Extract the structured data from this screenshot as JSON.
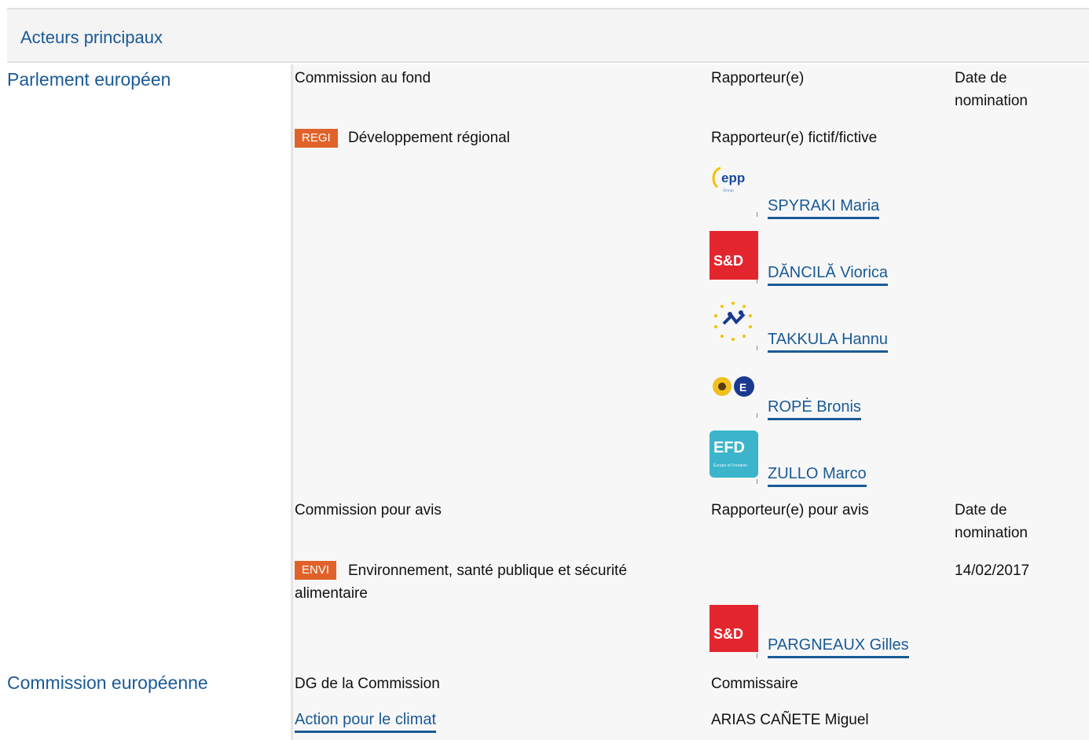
{
  "section": {
    "title": "Acteurs principaux"
  },
  "parliament": {
    "label": "Parlement européen",
    "lead": {
      "committee_header": "Commission au fond",
      "rapporteur_header": "Rapporteur(e)",
      "date_header": "Date de nomination",
      "committee_code": "REGI",
      "committee_name": "Développement régional",
      "shadow_header": "Rapporteur(e) fictif/fictive",
      "shadows": [
        {
          "group": "epp",
          "name": "SPYRAKI Maria"
        },
        {
          "group": "S&D",
          "name": "DĂNCILĂ Viorica"
        },
        {
          "group": "alde-stars",
          "name": "TAKKULA Hannu"
        },
        {
          "group": "greens-efa",
          "name": "ROPĖ Bronis"
        },
        {
          "group": "EFD",
          "name": "ZULLO Marco"
        }
      ]
    },
    "opinion": {
      "committee_header": "Commission pour avis",
      "rapporteur_header": "Rapporteur(e) pour avis",
      "date_header": "Date de nomination",
      "committee_code": "ENVI",
      "committee_name": "Environnement, santé publique et sécurité alimentaire",
      "date": "14/02/2017",
      "rapporteur": {
        "group": "S&D",
        "name": "PARGNEAUX Gilles"
      }
    }
  },
  "commission": {
    "label": "Commission européenne",
    "dg_header": "DG de la Commission",
    "commissioner_header": "Commissaire",
    "dg": "Action pour le climat",
    "commissioner": "ARIAS CAÑETE Miguel"
  },
  "colors": {
    "link": "#1a5a96",
    "badge": "#e0622a",
    "sd": "#e3262e",
    "efd": "#3cb4cc"
  }
}
